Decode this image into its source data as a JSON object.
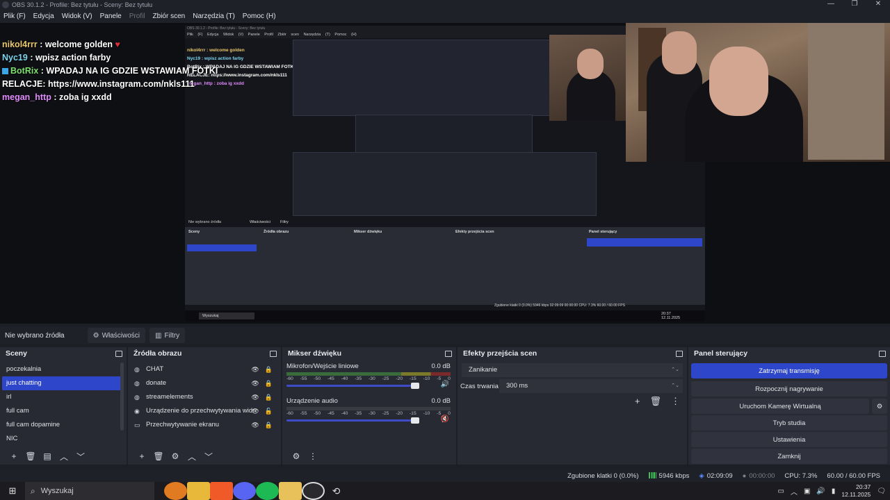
{
  "window": {
    "title": "OBS 30.1.2 - Profile: Bez tytułu - Sceny: Bez tytułu",
    "min": "—",
    "max": "❐",
    "close": "✕"
  },
  "menu": [
    "Plik (F)",
    "Edycja",
    "Widok (V)",
    "Panele",
    "Profil",
    "Zbiór scen",
    "Narzędzia (T)",
    "Pomoc (H)"
  ],
  "chat": [
    {
      "nick": "nikol4rrr",
      "msg": " : welcome golden ",
      "style": "nick-y",
      "heart": "♥"
    },
    {
      "nick": "Nyc19",
      "msg": " : wpisz action farby",
      "style": "nick-c",
      "heart": ""
    },
    {
      "nick": "BotRix",
      "msg": " : WPADAJ NA IG GDZIE WSTAWIAM FOTKI",
      "style": "nick-g",
      "heart": ""
    },
    {
      "nick": "",
      "msg": "RELACJE: https://www.instagram.com/nkls111",
      "style": "",
      "heart": ""
    },
    {
      "nick": "megan_http",
      "msg": " : zoba ig xxdd",
      "style": "nick-p",
      "heart": ""
    }
  ],
  "nested": {
    "title": "OBS 30.1.2 - Profile: Bez tytułu - Sceny: Bez tytułu",
    "menu": "Plik (F) Edycja Widok (V) Panele Profil Zbiór scen Narzędzia (T) Pomoc (H)",
    "chat1": "nikol4rrr : welcome golden",
    "chat2": "Nyc19 : wpisz action farby",
    "chat3": "BotRix : WPADAJ NA IG GDZIE WSTAWIAM FOTKI",
    "chat4": "RELACJE: https://www.instagram.com/nkls111",
    "chat5": "megan_http : zoba ig xxdd",
    "nosrc": "Nie wybrano źródła",
    "props": "Właściwości",
    "filters": "Filtry",
    "scenes": "Sceny",
    "sources": "Źródła obrazu",
    "mixer": "Mikser dźwięku",
    "trans": "Efekty przejścia scen",
    "control": "Panel sterujący",
    "search": "Wyszukaj",
    "status": "Zgubione klatki 0 (0.0%)   5946 kbps   02:09:09   00:00:00   CPU: 7.3%   60.00 / 60.00 FPS",
    "clock": "20:37",
    "date": "12.11.2025"
  },
  "toolbar": {
    "no_source": "Nie wybrano źródła",
    "properties": "Właściwości",
    "filters": "Filtry"
  },
  "scenes": {
    "title": "Sceny",
    "items": [
      "poczekalnia",
      "just chatting",
      "irl",
      "full cam",
      "full cam dopamine",
      "NIC"
    ],
    "selected": 1,
    "footer": [
      "+",
      "🗑",
      "▤",
      "︿",
      "﹀"
    ]
  },
  "sources": {
    "title": "Źródła obrazu",
    "items": [
      {
        "name": "CHAT",
        "icon": "browser-icon"
      },
      {
        "name": "donate",
        "icon": "browser-icon"
      },
      {
        "name": "streamelements",
        "icon": "browser-icon"
      },
      {
        "name": "Urządzenie do przechwytywania wideo",
        "icon": "camera-icon"
      },
      {
        "name": "Przechwytywanie ekranu",
        "icon": "monitor-icon"
      }
    ],
    "footer": [
      "+",
      "🗑",
      "⚙",
      "︿",
      "﹀"
    ]
  },
  "mixer": {
    "title": "Mikser dźwięku",
    "channels": [
      {
        "name": "Mikrofon/Wejście liniowe",
        "db": "0.0 dB",
        "muted": false,
        "level": 1.0
      },
      {
        "name": "Urządzenie audio",
        "db": "0.0 dB",
        "muted": true,
        "level": 1.0
      }
    ],
    "scale": [
      "-60",
      "-55",
      "-50",
      "-45",
      "-40",
      "-35",
      "-30",
      "-25",
      "-20",
      "-15",
      "-10",
      "-5",
      "0"
    ]
  },
  "transitions": {
    "title": "Efekty przejścia scen",
    "type": "Zanikanie",
    "duration_label": "Czas trwania",
    "duration": "300 ms"
  },
  "controls": {
    "title": "Panel sterujący",
    "buttons": [
      "Zatrzymaj transmisję",
      "Rozpocznij nagrywanie",
      "Uruchom Kamerę Wirtualną",
      "Tryb studia",
      "Ustawienia",
      "Zamknij"
    ]
  },
  "status": {
    "dropped": "Zgubione klatki 0 (0.0%)",
    "bitrate": "5946 kbps",
    "stream_time": "02:09:09",
    "rec_time": "00:00:00",
    "cpu": "CPU: 7.3%",
    "fps": "60.00 / 60.00 FPS"
  },
  "taskbar": {
    "search": "Wyszukaj",
    "time": "20:37",
    "date": "12.11.2025"
  },
  "colors": {
    "accent": "#2e46c9",
    "panel": "#272a33",
    "bg": "#1d1f26"
  }
}
